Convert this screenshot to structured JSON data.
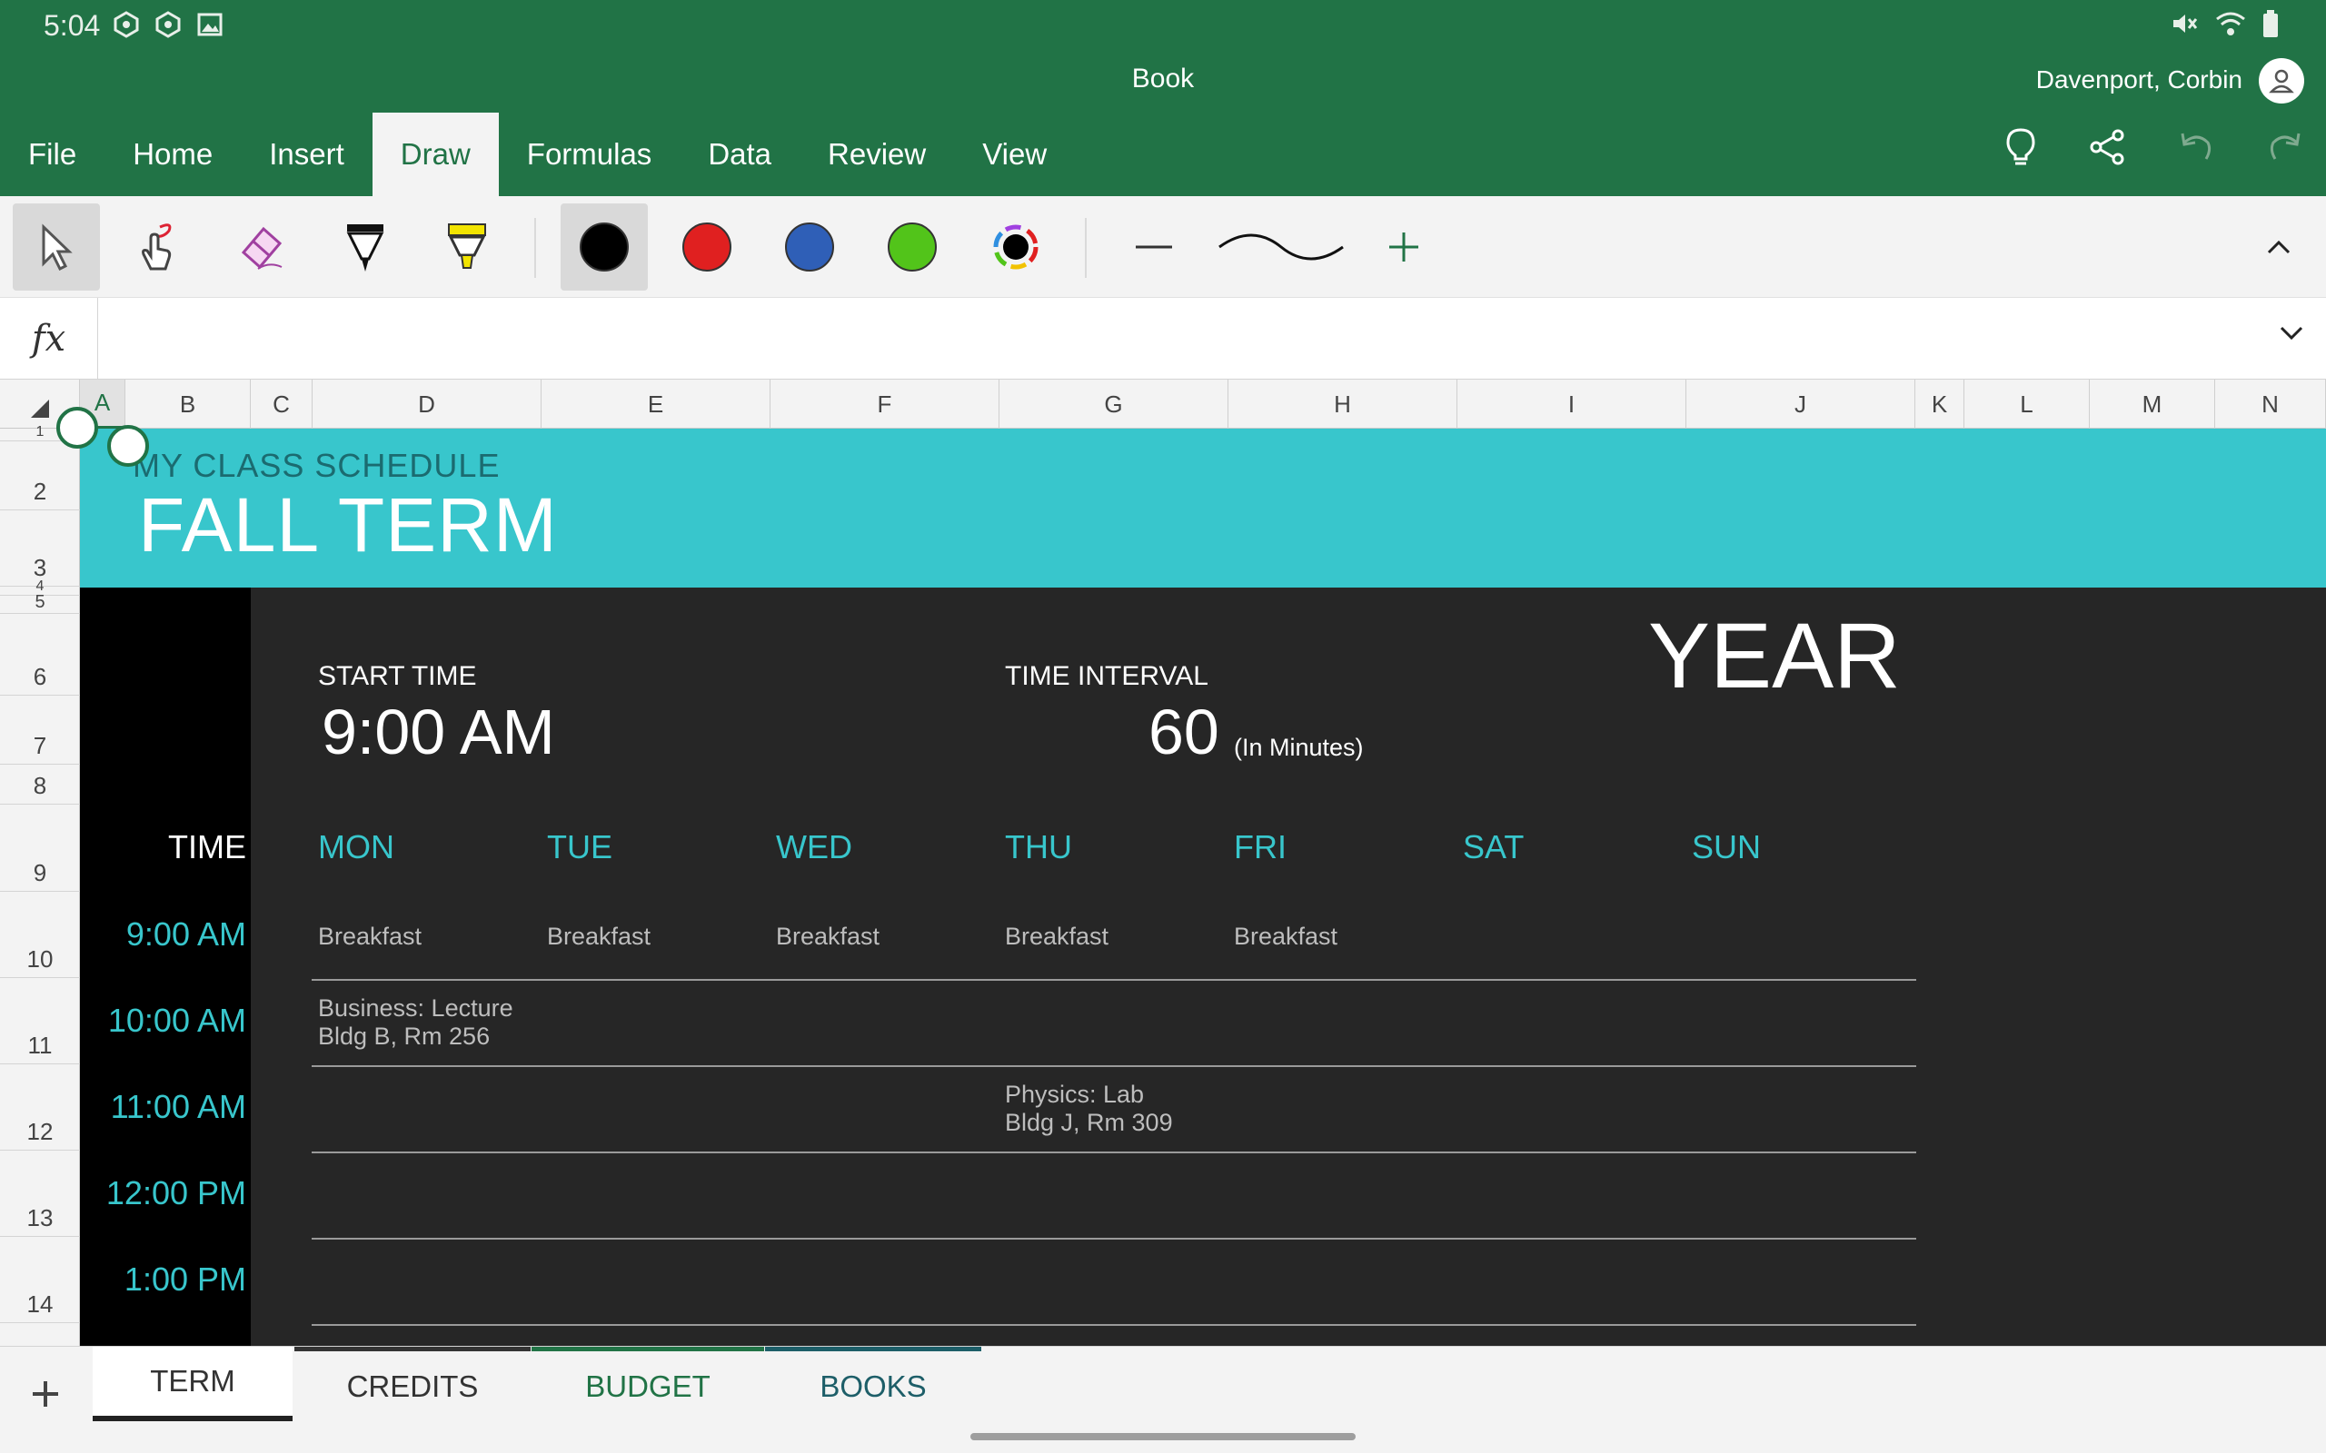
{
  "status": {
    "time": "5:04"
  },
  "app": {
    "doc_title": "Book",
    "user_name": "Davenport, Corbin"
  },
  "menu": [
    {
      "label": "File"
    },
    {
      "label": "Home"
    },
    {
      "label": "Insert"
    },
    {
      "label": "Draw",
      "active": true
    },
    {
      "label": "Formulas"
    },
    {
      "label": "Data"
    },
    {
      "label": "Review"
    },
    {
      "label": "View"
    }
  ],
  "ribbon": {
    "pen_colors": [
      "#000000",
      "#e02020",
      "#2f5fb7",
      "#52c41a"
    ],
    "selected_color": "#000000"
  },
  "formula_bar": {
    "fx": "fx",
    "value": ""
  },
  "columns": [
    "A",
    "B",
    "C",
    "D",
    "E",
    "F",
    "G",
    "H",
    "I",
    "J",
    "K",
    "L",
    "M",
    "N"
  ],
  "rows": [
    "1",
    "2",
    "3",
    "4",
    "5",
    "6",
    "7",
    "8",
    "9",
    "10",
    "11",
    "12",
    "13",
    "14"
  ],
  "sheet": {
    "subtitle": "MY CLASS SCHEDULE",
    "title": "FALL TERM",
    "start_time_label": "START TIME",
    "start_time": "9:00 AM",
    "interval_label": "TIME INTERVAL",
    "interval": "60",
    "interval_unit": "(In Minutes)",
    "year": "YEAR",
    "time_header": "TIME",
    "days": [
      "MON",
      "TUE",
      "WED",
      "THU",
      "FRI",
      "SAT",
      "SUN"
    ],
    "times": [
      "9:00 AM",
      "10:00 AM",
      "11:00 AM",
      "12:00 PM",
      "1:00 PM"
    ],
    "breakfast": [
      "Breakfast",
      "Breakfast",
      "Breakfast",
      "Breakfast",
      "Breakfast"
    ],
    "business_line1": "Business: Lecture",
    "business_line2": "Bldg B, Rm 256",
    "physics_line1": "Physics: Lab",
    "physics_line2": "Bldg J, Rm 309"
  },
  "tabs": [
    {
      "label": "TERM",
      "active": true,
      "color": "#222222"
    },
    {
      "label": "CREDITS",
      "color": "#333333"
    },
    {
      "label": "BUDGET",
      "color": "#217346"
    },
    {
      "label": "BOOKS",
      "color": "#1d5e68"
    }
  ],
  "colors": {
    "excel_green": "#217346",
    "teal": "#38c6cc"
  }
}
